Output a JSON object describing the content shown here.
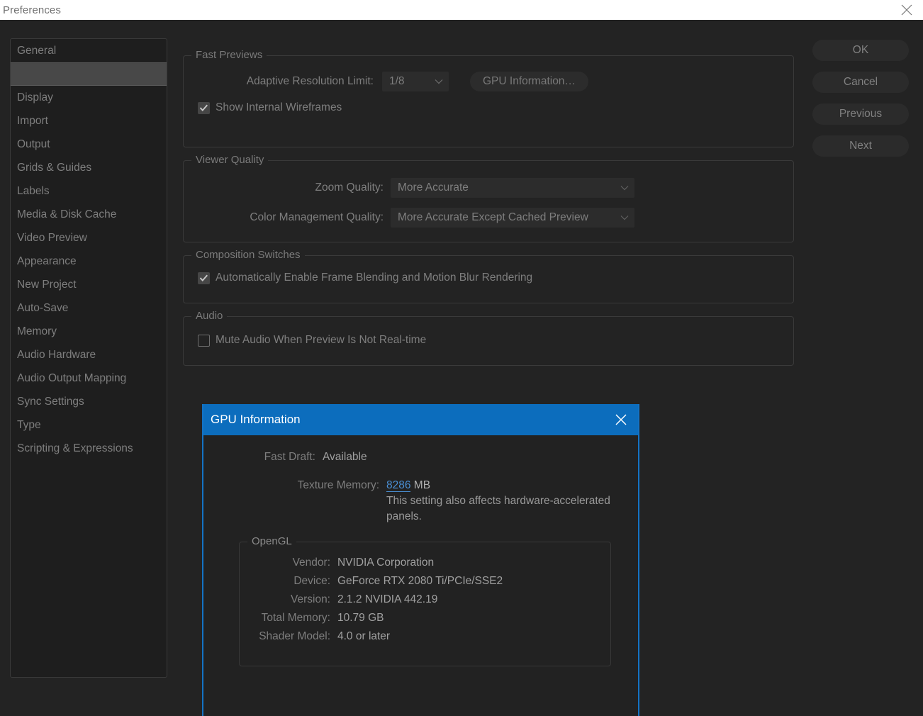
{
  "window": {
    "title": "Preferences",
    "close_icon": "close-icon"
  },
  "sidebar": {
    "items": [
      {
        "label": "General",
        "selected": false
      },
      {
        "label": "",
        "selected": true
      },
      {
        "label": "Display",
        "selected": false
      },
      {
        "label": "Import",
        "selected": false
      },
      {
        "label": "Output",
        "selected": false
      },
      {
        "label": "Grids & Guides",
        "selected": false
      },
      {
        "label": "Labels",
        "selected": false
      },
      {
        "label": "Media & Disk Cache",
        "selected": false
      },
      {
        "label": "Video Preview",
        "selected": false
      },
      {
        "label": "Appearance",
        "selected": false
      },
      {
        "label": "New Project",
        "selected": false
      },
      {
        "label": "Auto-Save",
        "selected": false
      },
      {
        "label": "Memory",
        "selected": false
      },
      {
        "label": "Audio Hardware",
        "selected": false
      },
      {
        "label": "Audio Output Mapping",
        "selected": false
      },
      {
        "label": "Sync Settings",
        "selected": false
      },
      {
        "label": "Type",
        "selected": false
      },
      {
        "label": "Scripting & Expressions",
        "selected": false
      }
    ]
  },
  "groups": {
    "fast_previews": {
      "title": "Fast Previews",
      "adaptive_resolution_label": "Adaptive Resolution Limit:",
      "adaptive_resolution_value": "1/8",
      "gpu_information_button": "GPU Information…",
      "show_internal_wireframes_label": "Show Internal Wireframes",
      "show_internal_wireframes_checked": true
    },
    "viewer_quality": {
      "title": "Viewer Quality",
      "zoom_quality_label": "Zoom Quality:",
      "zoom_quality_value": "More Accurate",
      "color_management_label": "Color Management Quality:",
      "color_management_value": "More Accurate Except Cached Preview"
    },
    "composition_switches": {
      "title": "Composition Switches",
      "auto_enable_label": "Automatically Enable Frame Blending and Motion Blur Rendering",
      "auto_enable_checked": true
    },
    "audio": {
      "title": "Audio",
      "mute_label": "Mute Audio When Preview Is Not Real-time",
      "mute_checked": false
    }
  },
  "actions": {
    "ok": "OK",
    "cancel": "Cancel",
    "previous": "Previous",
    "next": "Next"
  },
  "gpu_dialog": {
    "title": "GPU Information",
    "close_icon": "close-icon",
    "fast_draft_label": "Fast Draft:",
    "fast_draft_value": "Available",
    "texture_memory_label": "Texture Memory:",
    "texture_memory_value": "8286",
    "texture_memory_unit": "MB",
    "note": "This setting also affects hardware-accelerated panels.",
    "opengl": {
      "title": "OpenGL",
      "rows": [
        {
          "label": "Vendor:",
          "value": "NVIDIA Corporation"
        },
        {
          "label": "Device:",
          "value": "GeForce RTX 2080 Ti/PCIe/SSE2"
        },
        {
          "label": "Version:",
          "value": "2.1.2 NVIDIA 442.19"
        },
        {
          "label": "Total Memory:",
          "value": "10.79 GB"
        },
        {
          "label": "Shader Model:",
          "value": "4.0 or later"
        }
      ]
    }
  },
  "colors": {
    "accent_blue": "#0c6dbd",
    "dialog_border": "#1473c4",
    "scrub_value": "#4a8fd4",
    "window_bg": "#232323",
    "panel_bg": "#1e1e1e"
  }
}
